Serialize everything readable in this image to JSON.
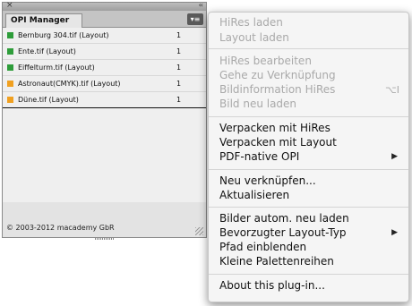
{
  "panel": {
    "close_glyph": "×",
    "collapse_glyph": "‹‹",
    "tab_label": "OPI Manager",
    "menu_button_glyph": "▾≡",
    "rows": [
      {
        "name": "Bernburg 304.tif (Layout)",
        "count": "1",
        "color": "#2e9d3a"
      },
      {
        "name": "Ente.tif (Layout)",
        "count": "1",
        "color": "#2e9d3a"
      },
      {
        "name": "Eiffelturm.tif (Layout)",
        "count": "1",
        "color": "#2e9d3a"
      },
      {
        "name": "Astronaut(CMYK).tif (Layout)",
        "count": "1",
        "color": "#f0a020"
      },
      {
        "name": "Düne.tif (Layout)",
        "count": "1",
        "color": "#f0a020"
      }
    ],
    "copyright": "© 2003-2012 macademy GbR"
  },
  "menu": {
    "hires_laden": "HiRes laden",
    "layout_laden": "Layout laden",
    "hires_bearbeiten": "HiRes bearbeiten",
    "gehe_zu": "Gehe zu Verknüpfung",
    "bildinformation": "Bildinformation HiRes",
    "bildinformation_shortcut": "⌥I",
    "bild_neu_laden": "Bild neu laden",
    "verpacken_hires": "Verpacken mit HiRes",
    "verpacken_layout": "Verpacken mit Layout",
    "pdf_native": "PDF-native OPI",
    "neu_verknuepfen": "Neu verknüpfen...",
    "aktualisieren": "Aktualisieren",
    "bilder_autom": "Bilder autom. neu laden",
    "bevorzugter": "Bevorzugter Layout-Typ",
    "pfad_einblenden": "Pfad einblenden",
    "kleine_paletten": "Kleine Palettenreihen",
    "about": "About this plug-in...",
    "submenu_arrow": "▶"
  }
}
